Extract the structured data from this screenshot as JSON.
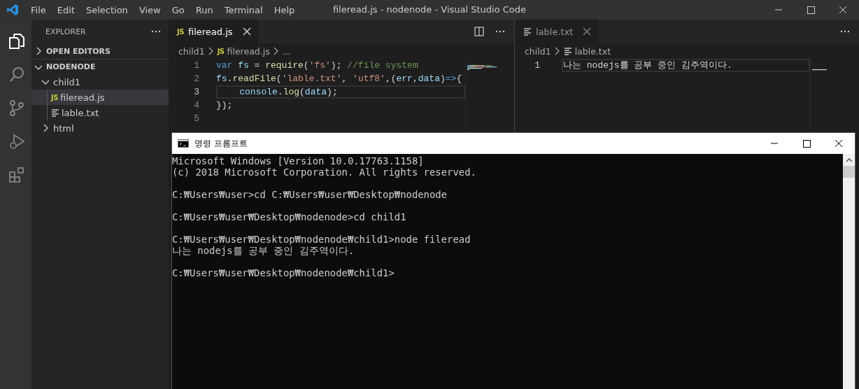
{
  "window": {
    "title": "fileread.js - nodenode - Visual Studio Code"
  },
  "menu": [
    "File",
    "Edit",
    "Selection",
    "View",
    "Go",
    "Run",
    "Terminal",
    "Help"
  ],
  "activity_bar": [
    {
      "kind": "files",
      "selected": true
    },
    {
      "kind": "search",
      "selected": false
    },
    {
      "kind": "source-control",
      "selected": false
    },
    {
      "kind": "run",
      "selected": false
    },
    {
      "kind": "extensions",
      "selected": false
    }
  ],
  "explorer": {
    "title": "EXPLORER",
    "sections": [
      {
        "label": "OPEN EDITORS",
        "expanded": false
      },
      {
        "label": "NODENODE",
        "expanded": true,
        "children": [
          {
            "label": "child1",
            "kind": "folder",
            "expanded": true,
            "children": [
              {
                "label": "fileread.js",
                "kind": "js",
                "icon_text": "JS",
                "selected": true
              },
              {
                "label": "lable.txt",
                "kind": "txt",
                "selected": false
              }
            ]
          },
          {
            "label": "html",
            "kind": "folder",
            "expanded": false
          }
        ]
      }
    ]
  },
  "editors": [
    {
      "tabs": [
        {
          "label": "fileread.js",
          "kind": "js",
          "icon_text": "JS",
          "selected": true
        }
      ],
      "split_button": true,
      "breadcrumb": [
        {
          "label": "child1",
          "kind": "folder"
        },
        {
          "label": "fileread.js",
          "kind": "js",
          "icon_text": "JS"
        },
        {
          "label": "...",
          "kind": "more"
        }
      ],
      "lines": [
        {
          "number": "1",
          "current": false,
          "tokens": [
            {
              "text": "var",
              "kind": "keyword"
            },
            {
              "text": " fs",
              "kind": "variable"
            },
            {
              "text": " = ",
              "kind": "plain"
            },
            {
              "text": "require",
              "kind": "function"
            },
            {
              "text": "(",
              "kind": "plain"
            },
            {
              "text": "'fs'",
              "kind": "string"
            },
            {
              "text": "); ",
              "kind": "plain"
            },
            {
              "text": "//file system",
              "kind": "comment"
            }
          ]
        },
        {
          "number": "2",
          "current": false,
          "tokens": [
            {
              "text": "fs",
              "kind": "variable"
            },
            {
              "text": ".",
              "kind": "plain"
            },
            {
              "text": "readFile",
              "kind": "function"
            },
            {
              "text": "(",
              "kind": "plain"
            },
            {
              "text": "'lable.txt'",
              "kind": "string"
            },
            {
              "text": ", ",
              "kind": "plain"
            },
            {
              "text": "'utf8'",
              "kind": "string"
            },
            {
              "text": ",(",
              "kind": "plain"
            },
            {
              "text": "err",
              "kind": "variable"
            },
            {
              "text": ",",
              "kind": "plain"
            },
            {
              "text": "data",
              "kind": "variable"
            },
            {
              "text": ")",
              "kind": "plain"
            },
            {
              "text": "=>",
              "kind": "keyword"
            },
            {
              "text": "{",
              "kind": "plain"
            }
          ]
        },
        {
          "number": "3",
          "current": true,
          "tokens": [
            {
              "text": "    console",
              "kind": "variable"
            },
            {
              "text": ".",
              "kind": "plain"
            },
            {
              "text": "log",
              "kind": "function"
            },
            {
              "text": "(",
              "kind": "plain"
            },
            {
              "text": "data",
              "kind": "variable"
            },
            {
              "text": ");",
              "kind": "plain"
            }
          ]
        },
        {
          "number": "4",
          "current": false,
          "tokens": [
            {
              "text": "});",
              "kind": "plain"
            }
          ]
        },
        {
          "number": "5",
          "current": false
        }
      ]
    },
    {
      "tabs": [
        {
          "label": "lable.txt",
          "kind": "txt",
          "selected": false
        }
      ],
      "split_button": false,
      "breadcrumb": [
        {
          "label": "child1",
          "kind": "folder"
        },
        {
          "label": "lable.txt",
          "kind": "txt"
        }
      ],
      "lines": [
        {
          "number": "1",
          "current": true,
          "tokens": [
            {
              "text": "나는 nodejs를 공부 중인 김주역이다.",
              "kind": "plain"
            }
          ]
        }
      ]
    }
  ],
  "command_prompt": {
    "title": "명령 프롬프트",
    "blocks": [
      [
        "Microsoft Windows [Version 10.0.17763.1158]",
        "(c) 2018 Microsoft Corporation. All rights reserved."
      ],
      [
        "C:₩Users₩user>cd C:₩Users₩user₩Desktop₩nodenode"
      ],
      [
        "C:₩Users₩user₩Desktop₩nodenode>cd child1"
      ],
      [
        "C:₩Users₩user₩Desktop₩nodenode₩child1>node fileread",
        "나는 nodejs를 공부 중인 김주역이다."
      ],
      [
        "C:₩Users₩user₩Desktop₩nodenode₩child1>"
      ]
    ]
  }
}
